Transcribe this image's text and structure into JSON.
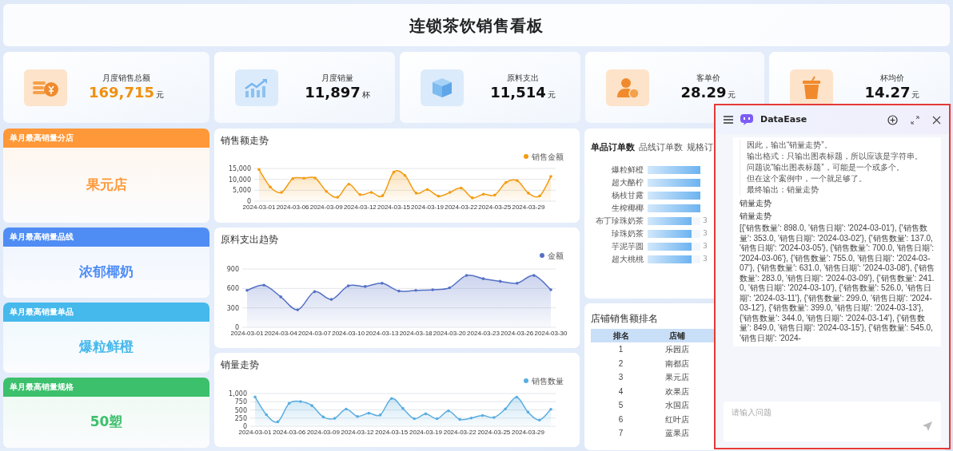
{
  "dashboard_title": "连锁茶饮销售看板",
  "kpis": [
    {
      "label": "月度销售总额",
      "value": "169,715",
      "unit": "元",
      "kind": "coins",
      "highlight": true
    },
    {
      "label": "月度销量",
      "value": "11,897",
      "unit": "杯",
      "kind": "growth",
      "highlight": false
    },
    {
      "label": "原料支出",
      "value": "11,514",
      "unit": "元",
      "kind": "box",
      "highlight": false
    },
    {
      "label": "客单价",
      "value": "28.29",
      "unit": "元",
      "kind": "person",
      "highlight": false
    },
    {
      "label": "杯均价",
      "value": "14.27",
      "unit": "元",
      "kind": "cup",
      "highlight": false
    }
  ],
  "highlights": [
    {
      "label": "单月最高销量分店",
      "value": "果元店",
      "color": "#ff9838"
    },
    {
      "label": "单月最高销量品线",
      "value": "浓郁椰奶",
      "color": "#4f8df5"
    },
    {
      "label": "单月最高销量单品",
      "value": "爆粒鲜橙",
      "color": "#45b8ec"
    },
    {
      "label": "单月最高销量规格",
      "value": "50塑",
      "color": "#3cc06c"
    }
  ],
  "charts": [
    {
      "title": "销售额走势",
      "chart_data": {
        "type": "area",
        "categories": [
          "2024-03-01",
          null,
          null,
          "2024-03-06",
          null,
          null,
          "2024-03-09",
          null,
          null,
          "2024-03-12",
          null,
          null,
          "2024-03-15",
          null,
          null,
          "2024-03-19",
          null,
          null,
          "2024-03-22",
          null,
          null,
          "2024-03-25",
          null,
          null,
          "2024-03-29",
          null,
          null
        ],
        "series": [
          {
            "name": "销售金额",
            "color": "#f39c12",
            "values": [
              14500,
              6500,
              4000,
              10300,
              10500,
              10600,
              4500,
              1800,
              7800,
              3000,
              4000,
              2500,
              13300,
              11800,
              3700,
              5300,
              2300,
              4000,
              6000,
              1500,
              3200,
              2800,
              8600,
              9400,
              3700,
              2400,
              11300
            ]
          }
        ],
        "grid": true,
        "ylim": [
          0,
          15000
        ],
        "yticks": [
          {
            "value": 0,
            "label": "0"
          },
          {
            "value": 5000,
            "label": "5,000"
          },
          {
            "value": 10000,
            "label": "10,000"
          },
          {
            "value": 15000,
            "label": "15,000"
          }
        ]
      }
    },
    {
      "title": "原料支出趋势",
      "chart_data": {
        "type": "area",
        "categories": [
          "2024-03-01",
          null,
          "2024-03-04",
          null,
          "2024-03-07",
          null,
          "2024-03-10",
          null,
          "2024-03-13",
          null,
          "2024-03-18",
          null,
          "2024-03-20",
          null,
          "2024-03-23",
          null,
          "2024-03-26",
          null,
          "2024-03-30"
        ],
        "series": [
          {
            "name": "金额",
            "color": "#5470c6",
            "values": [
              570,
              650,
              470,
              270,
              550,
              430,
              640,
              630,
              680,
              560,
              570,
              580,
              610,
              800,
              750,
              710,
              680,
              800,
              580
            ]
          }
        ],
        "grid": true,
        "ylim": [
          0,
          900
        ],
        "yticks": [
          0,
          300,
          600,
          900
        ]
      }
    },
    {
      "title": "销量走势",
      "chart_data": {
        "type": "area",
        "categories": [
          "2024-03-01",
          null,
          null,
          "2024-03-06",
          null,
          null,
          "2024-03-09",
          null,
          null,
          "2024-03-12",
          null,
          null,
          "2024-03-15",
          null,
          null,
          "2024-03-19",
          null,
          null,
          "2024-03-22",
          null,
          null,
          "2024-03-25",
          null,
          null,
          "2024-03-29",
          null,
          null
        ],
        "series": [
          {
            "name": "销售数量",
            "color": "#5aaee0",
            "values": [
              898,
              353,
              137,
              700,
              755,
              631,
              283,
              241,
              526,
              299,
              399,
              344,
              849,
              545,
              232,
              380,
              230,
              470,
              210,
              250,
              330,
              270,
              530,
              890,
              430,
              190,
              520
            ]
          }
        ],
        "grid": true,
        "ylim": [
          0,
          1000
        ],
        "yticks": [
          {
            "value": 0,
            "label": "0"
          },
          {
            "value": 250,
            "label": "250"
          },
          {
            "value": 500,
            "label": "500"
          },
          {
            "value": 750,
            "label": "750"
          },
          {
            "value": 1000,
            "label": "1,000"
          }
        ]
      }
    }
  ],
  "order_tabs": [
    {
      "label": "单品订单数",
      "selected": true
    },
    {
      "label": "品线订单数",
      "selected": false
    },
    {
      "label": "规格订",
      "selected": false
    }
  ],
  "order_bars": [
    {
      "label": "爆粒鲜橙",
      "level": 1
    },
    {
      "label": "超大酪柠",
      "level": 1
    },
    {
      "label": "杨枝甘露",
      "level": 1
    },
    {
      "label": "生榨椰椰",
      "level": 1
    },
    {
      "label": "布丁珍珠奶茶",
      "level": 0.84,
      "value": "3"
    },
    {
      "label": "珍珠奶茶",
      "level": 0.84,
      "value": "3"
    },
    {
      "label": "芋泥芋圆",
      "level": 0.84,
      "value": "3"
    },
    {
      "label": "超大桃桃",
      "level": 0.84,
      "value": "3"
    }
  ],
  "store_ranking": {
    "title": "店铺销售额排名",
    "columns": [
      "排名",
      "店铺"
    ],
    "rows": [
      [
        "1",
        "乐园店"
      ],
      [
        "2",
        "南都店"
      ],
      [
        "3",
        "果元店"
      ],
      [
        "4",
        "欢果店"
      ],
      [
        "5",
        "水国店"
      ],
      [
        "6",
        "红叶店"
      ],
      [
        "7",
        "蓝果店"
      ]
    ]
  },
  "chat": {
    "title": "DataEase",
    "thinking": [
      "因此，输出“销量走势”。",
      "输出格式：只输出图表标题，所以应该是字符串。",
      "问题说“输出图表标题”，可能是一个或多个。",
      "但在这个案例中，一个就足够了。",
      "最终输出：销量走势"
    ],
    "answers": [
      "销量走势",
      "销量走势"
    ],
    "result": "[{'销售数量': 898.0, '销售日期': '2024-03-01'}, {'销售数量': 353.0, '销售日期': '2024-03-02'}, {'销售数量': 137.0, '销售日期': '2024-03-05'}, {'销售数量': 700.0, '销售日期': '2024-03-06'}, {'销售数量': 755.0, '销售日期': '2024-03-07'}, {'销售数量': 631.0, '销售日期': '2024-03-08'}, {'销售数量': 283.0, '销售日期': '2024-03-09'}, {'销售数量': 241.0, '销售日期': '2024-03-10'}, {'销售数量': 526.0, '销售日期': '2024-03-11'}, {'销售数量': 299.0, '销售日期': '2024-03-12'}, {'销售数量': 399.0, '销售日期': '2024-03-13'}, {'销售数量': 344.0, '销售日期': '2024-03-14'}, {'销售数量': 849.0, '销售日期': '2024-03-15'}, {'销售数量': 545.0, '销售日期': '2024-",
    "input": {
      "placeholder": "请输入问题"
    }
  }
}
